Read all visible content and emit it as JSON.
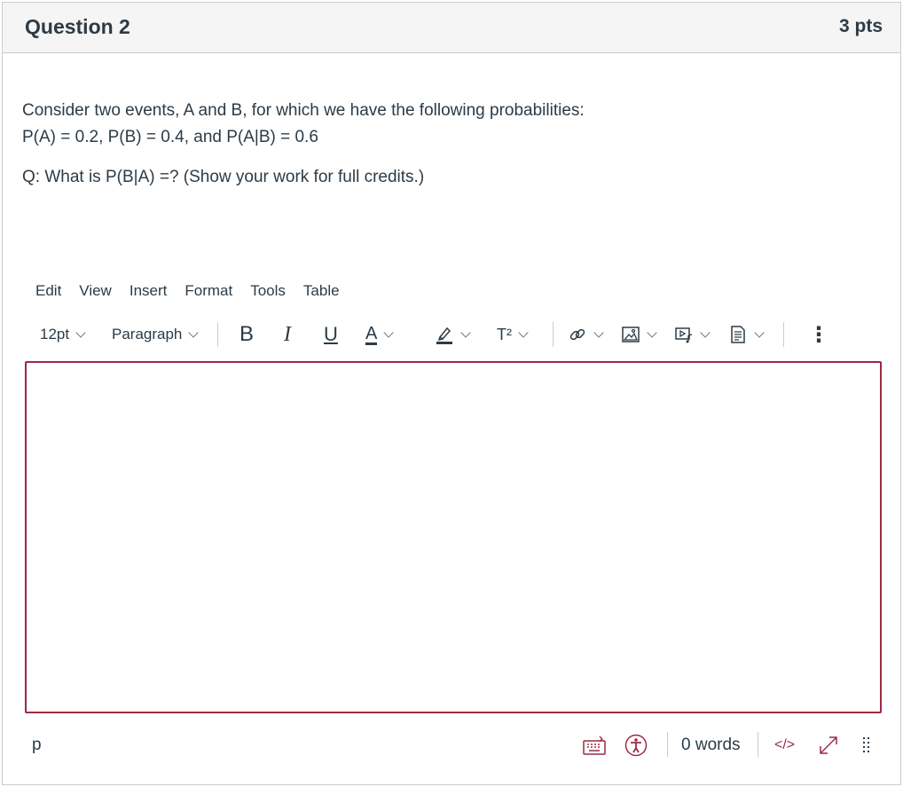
{
  "question": {
    "title": "Question 2",
    "points": "3 pts",
    "line1": "Consider two events, A and B, for which we have the following probabilities:",
    "line2": "P(A) = 0.2, P(B) = 0.4, and P(A|B) = 0.6",
    "line3": "Q: What is P(B|A) =? (Show your work for full credits.)"
  },
  "editor": {
    "menu": [
      "Edit",
      "View",
      "Insert",
      "Format",
      "Tools",
      "Table"
    ],
    "font_size": "12pt",
    "block_format": "Paragraph",
    "bold_glyph": "B",
    "italic_glyph": "I",
    "underline_glyph": "U",
    "text_color_glyph": "A",
    "superscript_glyph": "T²",
    "more_glyph": "⋮",
    "content": "",
    "path_label": "p",
    "word_count": "0 words",
    "html_toggle": "</>",
    "accent_color": "#9c2a43"
  }
}
